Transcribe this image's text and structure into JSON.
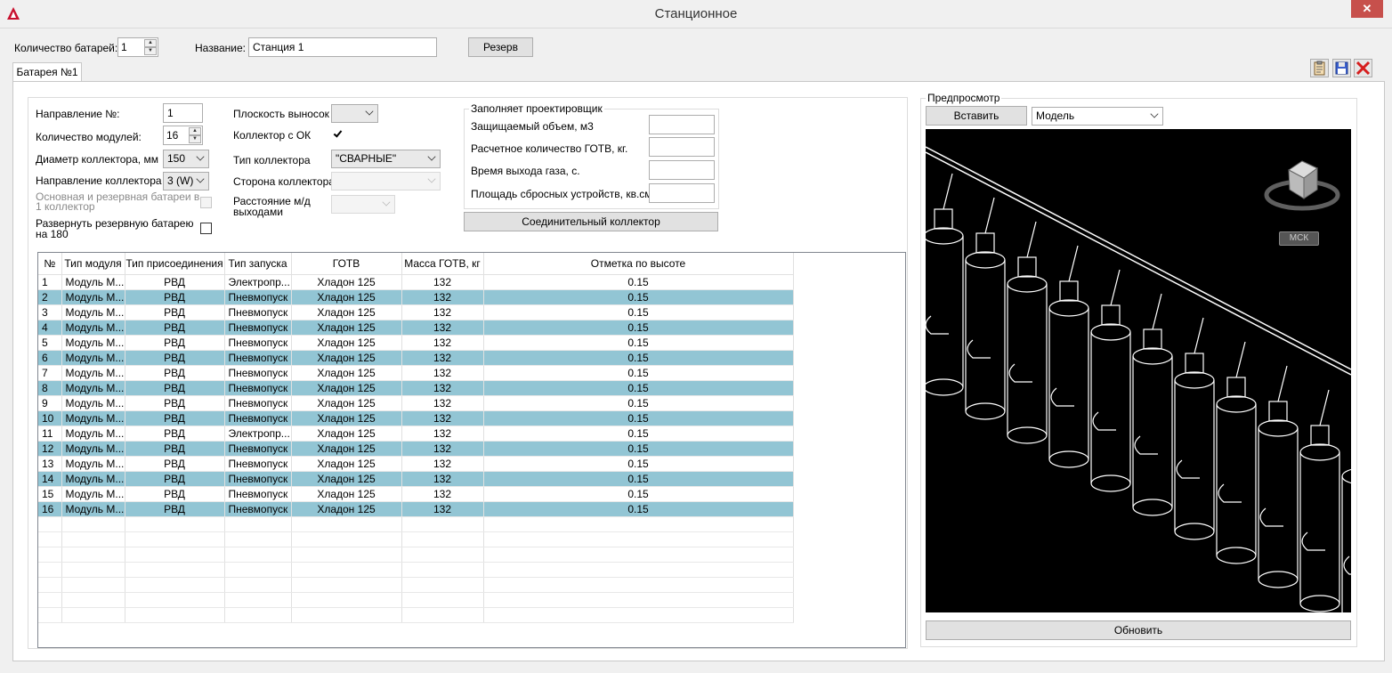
{
  "window": {
    "title": "Станционное",
    "close_glyph": "✕"
  },
  "header": {
    "battery_count_label": "Количество батарей:",
    "battery_count_value": "1",
    "name_label": "Название:",
    "name_value": "Станция 1",
    "reserve_button": "Резерв"
  },
  "tab": {
    "label": "Батарея №1"
  },
  "form": {
    "direction_label": "Направление №:",
    "direction_value": "1",
    "modules_label": "Количество модулей:",
    "modules_value": "16",
    "diameter_label": "Диаметр коллектора, мм",
    "diameter_value": "150",
    "collector_direction_label": "Направление коллектора",
    "collector_direction_value": "3 (W)",
    "main_reserve_label": "Основная и резервная батареи в 1 коллектор",
    "rotate_reserve_label": "Развернуть резервную батарею на 180",
    "callout_plane_label": "Плоскость выносок",
    "callout_plane_value": "",
    "collector_ok_label": "Коллектор с ОК",
    "collector_type_label": "Тип коллектора",
    "collector_type_value": "\"СВАРНЫЕ\"",
    "collector_side_label": "Сторона коллектора",
    "outlet_distance_label": "Расстояние м/д выходами"
  },
  "designer": {
    "title": "Заполняет проектировщик",
    "protected_volume_label": "Защищаемый объем, м3",
    "gotv_amount_label": "Расчетное количество ГОТВ, кг.",
    "gas_time_label": "Время выхода газа, с.",
    "relief_area_label": "Площадь сбросных устройств, кв.см.",
    "connecting_collector_button": "Соединительный коллектор"
  },
  "preview": {
    "title": "Предпросмотр",
    "insert_button": "Вставить",
    "view_select_value": "Модель",
    "ucs_label": "МСК",
    "refresh_button": "Обновить"
  },
  "table": {
    "headers": [
      "№",
      "Тип модуля",
      "Тип присоединения",
      "Тип запуска",
      "ГОТВ",
      "Масса ГОТВ, кг",
      "Отметка по высоте"
    ],
    "rows": [
      [
        "1",
        "Модуль М...",
        "РВД",
        "Электропр...",
        "Хладон 125",
        "132",
        "0.15"
      ],
      [
        "2",
        "Модуль М...",
        "РВД",
        "Пневмопуск",
        "Хладон 125",
        "132",
        "0.15"
      ],
      [
        "3",
        "Модуль М...",
        "РВД",
        "Пневмопуск",
        "Хладон 125",
        "132",
        "0.15"
      ],
      [
        "4",
        "Модуль М...",
        "РВД",
        "Пневмопуск",
        "Хладон 125",
        "132",
        "0.15"
      ],
      [
        "5",
        "Модуль М...",
        "РВД",
        "Пневмопуск",
        "Хладон 125",
        "132",
        "0.15"
      ],
      [
        "6",
        "Модуль М...",
        "РВД",
        "Пневмопуск",
        "Хладон 125",
        "132",
        "0.15"
      ],
      [
        "7",
        "Модуль М...",
        "РВД",
        "Пневмопуск",
        "Хладон 125",
        "132",
        "0.15"
      ],
      [
        "8",
        "Модуль М...",
        "РВД",
        "Пневмопуск",
        "Хладон 125",
        "132",
        "0.15"
      ],
      [
        "9",
        "Модуль М...",
        "РВД",
        "Пневмопуск",
        "Хладон 125",
        "132",
        "0.15"
      ],
      [
        "10",
        "Модуль М...",
        "РВД",
        "Пневмопуск",
        "Хладон 125",
        "132",
        "0.15"
      ],
      [
        "11",
        "Модуль М...",
        "РВД",
        "Электропр...",
        "Хладон 125",
        "132",
        "0.15"
      ],
      [
        "12",
        "Модуль М...",
        "РВД",
        "Пневмопуск",
        "Хладон 125",
        "132",
        "0.15"
      ],
      [
        "13",
        "Модуль М...",
        "РВД",
        "Пневмопуск",
        "Хладон 125",
        "132",
        "0.15"
      ],
      [
        "14",
        "Модуль М...",
        "РВД",
        "Пневмопуск",
        "Хладон 125",
        "132",
        "0.15"
      ],
      [
        "15",
        "Модуль М...",
        "РВД",
        "Пневмопуск",
        "Хладон 125",
        "132",
        "0.15"
      ],
      [
        "16",
        "Модуль М...",
        "РВД",
        "Пневмопуск",
        "Хладон 125",
        "132",
        "0.15"
      ]
    ]
  }
}
